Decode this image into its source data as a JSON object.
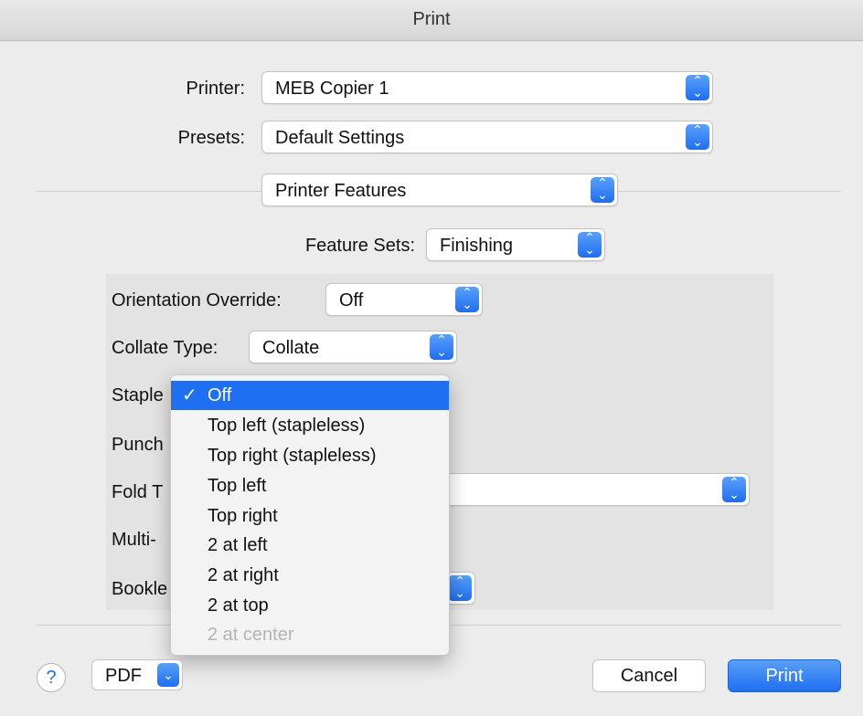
{
  "window": {
    "title": "Print"
  },
  "printer": {
    "label": "Printer:",
    "value": "MEB Copier 1"
  },
  "presets": {
    "label": "Presets:",
    "value": "Default Settings"
  },
  "section": {
    "value": "Printer Features"
  },
  "feature_sets": {
    "label": "Feature Sets:",
    "value": "Finishing"
  },
  "features": {
    "orientation_override": {
      "label": "Orientation Override:",
      "value": "Off"
    },
    "collate_type": {
      "label": "Collate Type:",
      "value": "Collate"
    },
    "staple": {
      "label": "Staple"
    },
    "punch": {
      "label": "Punch"
    },
    "fold": {
      "label": "Fold T"
    },
    "multi": {
      "label": "Multi-"
    },
    "booklet": {
      "label": "Bookle"
    }
  },
  "staple_menu": {
    "checkmark": "✓",
    "items": [
      {
        "label": "Off",
        "selected": true,
        "enabled": true
      },
      {
        "label": "Top left (stapleless)",
        "selected": false,
        "enabled": true
      },
      {
        "label": "Top right (stapleless)",
        "selected": false,
        "enabled": true
      },
      {
        "label": "Top left",
        "selected": false,
        "enabled": true
      },
      {
        "label": "Top right",
        "selected": false,
        "enabled": true
      },
      {
        "label": "2 at left",
        "selected": false,
        "enabled": true
      },
      {
        "label": "2 at right",
        "selected": false,
        "enabled": true
      },
      {
        "label": "2 at top",
        "selected": false,
        "enabled": true
      },
      {
        "label": "2 at center",
        "selected": false,
        "enabled": false
      }
    ]
  },
  "footer": {
    "help": "?",
    "pdf": "PDF",
    "cancel": "Cancel",
    "print": "Print"
  },
  "colors": {
    "accent": "#1e6ff1",
    "window_bg": "#ececec",
    "panel_bg": "#e3e3e3"
  }
}
